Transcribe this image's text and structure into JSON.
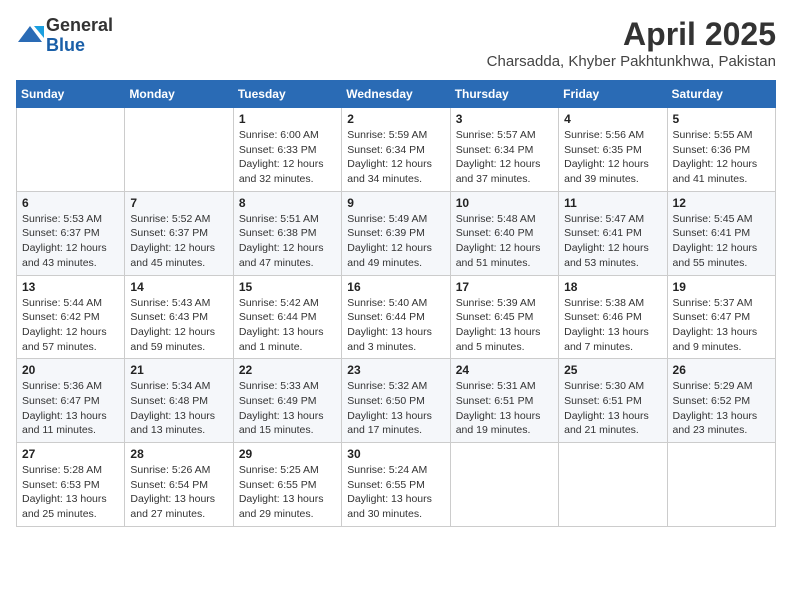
{
  "header": {
    "logo_line1": "General",
    "logo_line2": "Blue",
    "month_title": "April 2025",
    "subtitle": "Charsadda, Khyber Pakhtunkhwa, Pakistan"
  },
  "weekdays": [
    "Sunday",
    "Monday",
    "Tuesday",
    "Wednesday",
    "Thursday",
    "Friday",
    "Saturday"
  ],
  "weeks": [
    [
      {
        "day": "",
        "info": ""
      },
      {
        "day": "",
        "info": ""
      },
      {
        "day": "1",
        "info": "Sunrise: 6:00 AM\nSunset: 6:33 PM\nDaylight: 12 hours and 32 minutes."
      },
      {
        "day": "2",
        "info": "Sunrise: 5:59 AM\nSunset: 6:34 PM\nDaylight: 12 hours and 34 minutes."
      },
      {
        "day": "3",
        "info": "Sunrise: 5:57 AM\nSunset: 6:34 PM\nDaylight: 12 hours and 37 minutes."
      },
      {
        "day": "4",
        "info": "Sunrise: 5:56 AM\nSunset: 6:35 PM\nDaylight: 12 hours and 39 minutes."
      },
      {
        "day": "5",
        "info": "Sunrise: 5:55 AM\nSunset: 6:36 PM\nDaylight: 12 hours and 41 minutes."
      }
    ],
    [
      {
        "day": "6",
        "info": "Sunrise: 5:53 AM\nSunset: 6:37 PM\nDaylight: 12 hours and 43 minutes."
      },
      {
        "day": "7",
        "info": "Sunrise: 5:52 AM\nSunset: 6:37 PM\nDaylight: 12 hours and 45 minutes."
      },
      {
        "day": "8",
        "info": "Sunrise: 5:51 AM\nSunset: 6:38 PM\nDaylight: 12 hours and 47 minutes."
      },
      {
        "day": "9",
        "info": "Sunrise: 5:49 AM\nSunset: 6:39 PM\nDaylight: 12 hours and 49 minutes."
      },
      {
        "day": "10",
        "info": "Sunrise: 5:48 AM\nSunset: 6:40 PM\nDaylight: 12 hours and 51 minutes."
      },
      {
        "day": "11",
        "info": "Sunrise: 5:47 AM\nSunset: 6:41 PM\nDaylight: 12 hours and 53 minutes."
      },
      {
        "day": "12",
        "info": "Sunrise: 5:45 AM\nSunset: 6:41 PM\nDaylight: 12 hours and 55 minutes."
      }
    ],
    [
      {
        "day": "13",
        "info": "Sunrise: 5:44 AM\nSunset: 6:42 PM\nDaylight: 12 hours and 57 minutes."
      },
      {
        "day": "14",
        "info": "Sunrise: 5:43 AM\nSunset: 6:43 PM\nDaylight: 12 hours and 59 minutes."
      },
      {
        "day": "15",
        "info": "Sunrise: 5:42 AM\nSunset: 6:44 PM\nDaylight: 13 hours and 1 minute."
      },
      {
        "day": "16",
        "info": "Sunrise: 5:40 AM\nSunset: 6:44 PM\nDaylight: 13 hours and 3 minutes."
      },
      {
        "day": "17",
        "info": "Sunrise: 5:39 AM\nSunset: 6:45 PM\nDaylight: 13 hours and 5 minutes."
      },
      {
        "day": "18",
        "info": "Sunrise: 5:38 AM\nSunset: 6:46 PM\nDaylight: 13 hours and 7 minutes."
      },
      {
        "day": "19",
        "info": "Sunrise: 5:37 AM\nSunset: 6:47 PM\nDaylight: 13 hours and 9 minutes."
      }
    ],
    [
      {
        "day": "20",
        "info": "Sunrise: 5:36 AM\nSunset: 6:47 PM\nDaylight: 13 hours and 11 minutes."
      },
      {
        "day": "21",
        "info": "Sunrise: 5:34 AM\nSunset: 6:48 PM\nDaylight: 13 hours and 13 minutes."
      },
      {
        "day": "22",
        "info": "Sunrise: 5:33 AM\nSunset: 6:49 PM\nDaylight: 13 hours and 15 minutes."
      },
      {
        "day": "23",
        "info": "Sunrise: 5:32 AM\nSunset: 6:50 PM\nDaylight: 13 hours and 17 minutes."
      },
      {
        "day": "24",
        "info": "Sunrise: 5:31 AM\nSunset: 6:51 PM\nDaylight: 13 hours and 19 minutes."
      },
      {
        "day": "25",
        "info": "Sunrise: 5:30 AM\nSunset: 6:51 PM\nDaylight: 13 hours and 21 minutes."
      },
      {
        "day": "26",
        "info": "Sunrise: 5:29 AM\nSunset: 6:52 PM\nDaylight: 13 hours and 23 minutes."
      }
    ],
    [
      {
        "day": "27",
        "info": "Sunrise: 5:28 AM\nSunset: 6:53 PM\nDaylight: 13 hours and 25 minutes."
      },
      {
        "day": "28",
        "info": "Sunrise: 5:26 AM\nSunset: 6:54 PM\nDaylight: 13 hours and 27 minutes."
      },
      {
        "day": "29",
        "info": "Sunrise: 5:25 AM\nSunset: 6:55 PM\nDaylight: 13 hours and 29 minutes."
      },
      {
        "day": "30",
        "info": "Sunrise: 5:24 AM\nSunset: 6:55 PM\nDaylight: 13 hours and 30 minutes."
      },
      {
        "day": "",
        "info": ""
      },
      {
        "day": "",
        "info": ""
      },
      {
        "day": "",
        "info": ""
      }
    ]
  ]
}
